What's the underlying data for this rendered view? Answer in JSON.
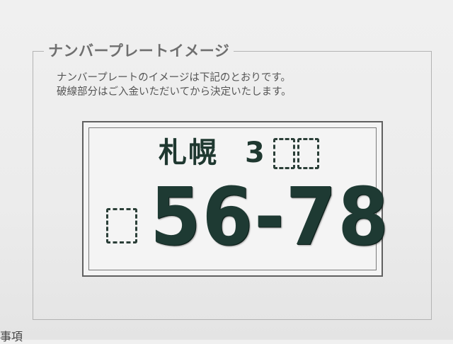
{
  "section": {
    "title": "ナンバープレートイメージ",
    "description_line1": "ナンバープレートのイメージは下記のとおりです。",
    "description_line2": "破線部分はご入金いただいてから決定いたします。"
  },
  "plate": {
    "region": "札幌",
    "class_number": "3",
    "serial": "56-78"
  },
  "footer": {
    "partial_text": "事項"
  }
}
